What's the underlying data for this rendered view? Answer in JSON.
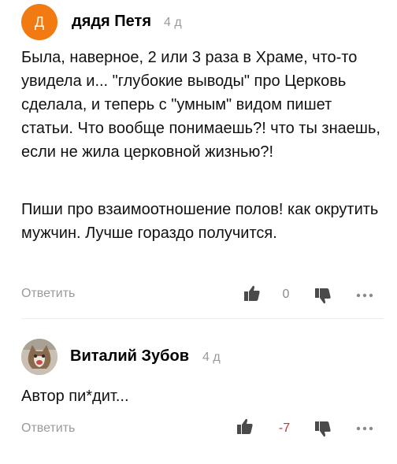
{
  "comments": [
    {
      "avatar_letter": "Д",
      "avatar_color": "#f27a13",
      "author": "дядя Петя",
      "time": "4 д",
      "paragraphs": [
        "Была, наверное, 2 или 3 раза в Храме, что-то увидела и... \"глубокие выводы\" про Церковь сделала, и теперь с \"умным\" видом пишет статьи. Что вообще понимаешь?! что ты знаешь, если не жила церковной жизнью?!",
        "Пиши про взаимоотношение полов! как окрутить мужчин. Лучше гораздо получится."
      ],
      "reply_label": "Ответить",
      "score": "0",
      "like_icon": "thumbs-up-icon",
      "dislike_icon": "thumbs-down-icon",
      "more_icon": "more-dots-icon"
    },
    {
      "avatar_icon": "cat-photo-avatar",
      "author": "Виталий Зубов",
      "time": "4 д",
      "paragraphs": [
        "Автор пи*дит..."
      ],
      "reply_label": "Ответить",
      "score": "-7",
      "score_color": "#d72d2d",
      "like_icon": "thumbs-up-icon",
      "dislike_icon": "thumbs-down-icon",
      "more_icon": "more-dots-icon"
    }
  ]
}
